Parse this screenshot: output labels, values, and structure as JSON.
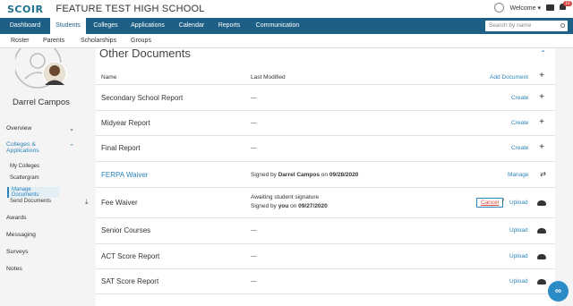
{
  "header": {
    "logo": "SCOIR",
    "school": "FEATURE TEST HIGH SCHOOL",
    "welcome": "Welcome",
    "notif_count": "10"
  },
  "nav": {
    "items": [
      "Dashboard",
      "Students",
      "Colleges",
      "Applications",
      "Calendar",
      "Reports",
      "Communication"
    ],
    "search_placeholder": "Search by name"
  },
  "subnav": {
    "items": [
      "Roster",
      "Parents",
      "Scholarships",
      "Groups"
    ]
  },
  "sidebar": {
    "student_name": "Darrel Campos",
    "items": {
      "overview": "Overview",
      "colleges": "Colleges &",
      "colleges2": "Applications",
      "my_colleges": "My Colleges",
      "scattergram": "Scattergram",
      "manage_documents": "Manage Documents",
      "send_documents": "Send Documents",
      "awards": "Awards",
      "messaging": "Messaging",
      "surveys": "Surveys",
      "notes": "Notes"
    }
  },
  "main": {
    "title": "Other Documents",
    "col_name": "Name",
    "col_modified": "Last Modified",
    "add_document": "Add Document",
    "rows": [
      {
        "name": "Secondary School Report",
        "modified": "—",
        "action": "Create"
      },
      {
        "name": "Midyear Report",
        "modified": "—",
        "action": "Create"
      },
      {
        "name": "Final Report",
        "modified": "—",
        "action": "Create"
      },
      {
        "name": "FERPA Waiver",
        "modified_prefix": "Signed by",
        "modified_who": "Darrel Campos",
        "modified_on": "on",
        "modified_date": "09/28/2020",
        "action": "Manage"
      },
      {
        "name": "Fee Waiver",
        "modified_line1": "Awaiting student signature",
        "modified_prefix": "Signed by",
        "modified_who": "you",
        "modified_on": "on",
        "modified_date": "09/27/2020",
        "cancel": "Cancel",
        "slash": "/",
        "action": "Upload"
      },
      {
        "name": "Senior Courses",
        "modified": "—",
        "action": "Upload"
      },
      {
        "name": "ACT Score Report",
        "modified": "—",
        "action": "Upload"
      },
      {
        "name": "SAT Score Report",
        "modified": "—",
        "action": "Upload"
      }
    ]
  },
  "colors": {
    "nav_bg": "#1e5f85",
    "link": "#2b84b8",
    "fab": "#2a8bc7"
  }
}
